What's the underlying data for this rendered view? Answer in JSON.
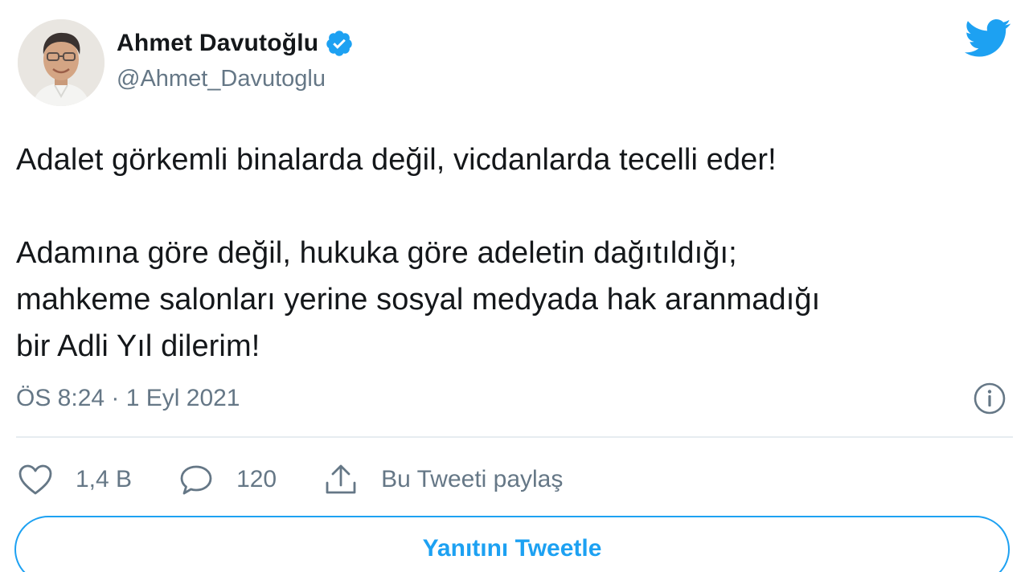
{
  "user": {
    "display_name": "Ahmet Davutoğlu",
    "handle": "@Ahmet_Davutoglu",
    "verified": true
  },
  "tweet": {
    "paragraph1": "Adalet görkemli binalarda değil, vicdanlarda tecelli eder!",
    "paragraph2_lines": [
      "Adamına göre değil, hukuka göre adeletin dağıtıldığı;",
      "mahkeme salonları yerine sosyal medyada hak aranmadığı",
      "bir Adli Yıl dilerim!"
    ],
    "timestamp": "ÖS 8:24 · 1 Eyl 2021"
  },
  "actions": {
    "likes": "1,4 B",
    "replies": "120",
    "share_label": "Bu Tweeti paylaş"
  },
  "reply_button_label": "Yanıtını Tweetle",
  "icons": {
    "logo": "twitter-bird-icon",
    "verified": "verified-badge-icon",
    "info": "info-icon",
    "like": "heart-icon",
    "reply": "speech-bubble-icon",
    "share": "share-upload-icon"
  },
  "colors": {
    "accent": "#1da1f2",
    "secondary_text": "#657786",
    "primary_text": "#14171a",
    "divider": "#e6ecf0"
  }
}
